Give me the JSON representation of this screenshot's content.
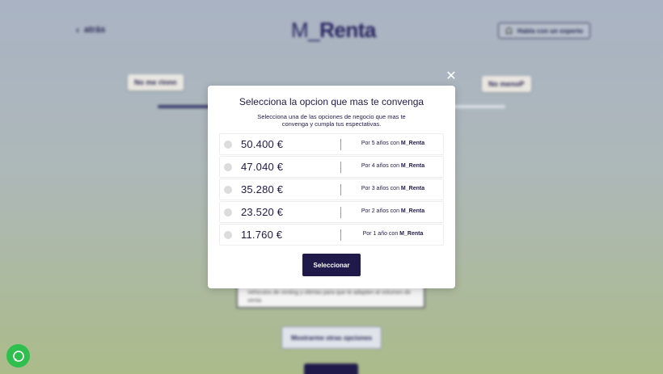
{
  "background": {
    "back_label": "atrás",
    "logo_prefix": "M",
    "logo_name": "Renta",
    "support_label": "Habla con un experto",
    "pill_left": "No me rinnn",
    "pill_right": "No menoP",
    "card_text": "Vehiculos de renting y ofertas para que te adapten al volumen de venta",
    "more_options_label": "Mostrarme otras opciones"
  },
  "modal": {
    "close_label": "✕",
    "title": "Selecciona la opcion que mas te convenga",
    "subtitle": "Selecciona una de las opciones de negocio que mas te convenga y cumpla tus espectativas.",
    "brand": "M_Renta",
    "options": [
      {
        "price": "50.400 €",
        "term": "Por 5 años con"
      },
      {
        "price": "47.040 €",
        "term": "Por 4 años con"
      },
      {
        "price": "35.280 €",
        "term": "Por 3 años con"
      },
      {
        "price": "23.520 €",
        "term": "Por 2 años con"
      },
      {
        "price": "11.760 €",
        "term": "Por 1 año con"
      }
    ],
    "select_label": "Seleccionar"
  },
  "colors": {
    "brand_navy": "#1f1a4a",
    "whatsapp_green": "#2fbf4e"
  }
}
